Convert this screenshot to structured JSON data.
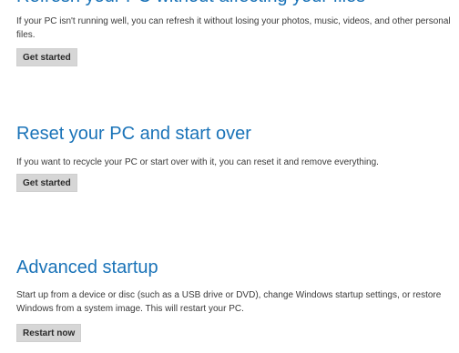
{
  "sections": [
    {
      "title": "Refresh your PC without affecting your files",
      "description": "If your PC isn't running well, you can refresh it without losing your photos, music, videos, and other personal files.",
      "button_label": "Get started"
    },
    {
      "title": "Reset your PC and start over",
      "description": "If you want to recycle your PC or start over with it, you can reset it and remove everything.",
      "button_label": "Get started"
    },
    {
      "title": "Advanced startup",
      "description": "Start up from a device or disc (such as a USB drive or DVD), change Windows startup settings, or restore Windows from a system image. This will restart your PC.",
      "button_label": "Restart now"
    }
  ],
  "colors": {
    "heading": "#1a73b8",
    "button_bg": "#d6d6d6",
    "text": "#3a3a3a"
  }
}
